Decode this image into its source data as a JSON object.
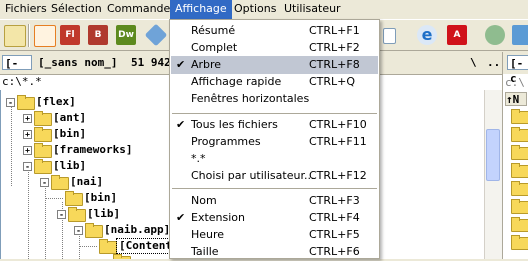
{
  "menubar": {
    "items": [
      "Fichiers",
      "Sélection",
      "Commandes",
      "Affichage",
      "Options",
      "Utilisateur"
    ],
    "active": "Affichage"
  },
  "toolbar": {
    "icons": [
      {
        "name": "notepad-icon",
        "color": "#6b8e23",
        "text": ""
      },
      {
        "name": "compress-icon",
        "color": "#e67e22",
        "text": ""
      },
      {
        "name": "flash-icon",
        "color": "#c0392b",
        "text": "Fl"
      },
      {
        "name": "bridge-icon",
        "color": "#b03a2e",
        "text": "B"
      },
      {
        "name": "dreamweaver-icon",
        "color": "#5d8a1e",
        "text": "Dw"
      },
      {
        "name": "cube-icon",
        "color": "#3d7ab8",
        "text": ""
      }
    ],
    "right_icons": [
      {
        "name": "internet-explorer-icon",
        "color": "#1e6fc7",
        "text": "e"
      },
      {
        "name": "acrobat-icon",
        "color": "#d0121a",
        "text": "A"
      },
      {
        "name": "users-icon",
        "color": "#2e7d32",
        "text": ""
      }
    ]
  },
  "left_panel": {
    "drive": "[-c-]",
    "volume": "[_sans nom_]",
    "free": "51 942",
    "backslash": "\\",
    "dotdot": "..",
    "path": "c:\\*.*"
  },
  "right_panel": {
    "drive": "[-c",
    "path": "c:\\",
    "header": "↑N"
  },
  "tree": [
    {
      "label": "[flex]",
      "level": 0,
      "expand": "-"
    },
    {
      "label": "[ant]",
      "level": 1,
      "expand": "+"
    },
    {
      "label": "[bin]",
      "level": 1,
      "expand": "+"
    },
    {
      "label": "[frameworks]",
      "level": 1,
      "expand": "+"
    },
    {
      "label": "[lib]",
      "level": 1,
      "expand": "-"
    },
    {
      "label": "[nai]",
      "level": 2,
      "expand": "-"
    },
    {
      "label": "[bin]",
      "level": 3,
      "expand": ""
    },
    {
      "label": "[lib]",
      "level": 3,
      "expand": "-"
    },
    {
      "label": "[naib.app]",
      "level": 4,
      "expand": "-"
    },
    {
      "label": "[Contents]",
      "level": 5,
      "expand": ""
    }
  ],
  "menu": {
    "groups": [
      [
        {
          "label": "Résumé",
          "shortcut": "CTRL+F1",
          "checked": false,
          "highlighted": false
        },
        {
          "label": "Complet",
          "shortcut": "CTRL+F2",
          "checked": false,
          "highlighted": false
        },
        {
          "label": "Arbre",
          "shortcut": "CTRL+F8",
          "checked": true,
          "highlighted": true
        },
        {
          "label": "Affichage rapide",
          "shortcut": "CTRL+Q",
          "checked": false,
          "highlighted": false
        },
        {
          "label": "Fenêtres horizontales",
          "shortcut": "",
          "checked": false,
          "highlighted": false
        }
      ],
      [
        {
          "label": "Tous les fichiers",
          "shortcut": "CTRL+F10",
          "checked": true,
          "highlighted": false
        },
        {
          "label": "Programmes",
          "shortcut": "CTRL+F11",
          "checked": false,
          "highlighted": false
        },
        {
          "label": "*.*",
          "shortcut": "",
          "checked": false,
          "highlighted": false
        },
        {
          "label": "Choisi par utilisateur...",
          "shortcut": "CTRL+F12",
          "checked": false,
          "highlighted": false
        }
      ],
      [
        {
          "label": "Nom",
          "shortcut": "CTRL+F3",
          "checked": false,
          "highlighted": false
        },
        {
          "label": "Extension",
          "shortcut": "CTRL+F4",
          "checked": true,
          "highlighted": false
        },
        {
          "label": "Heure",
          "shortcut": "CTRL+F5",
          "checked": false,
          "highlighted": false
        },
        {
          "label": "Taille",
          "shortcut": "CTRL+F6",
          "checked": false,
          "highlighted": false
        }
      ]
    ],
    "check_glyph": "✔"
  },
  "colors": {
    "menu_active": "#316ac5",
    "menu_highlight": "#c1c7d3",
    "folder": "#f7d85a"
  }
}
